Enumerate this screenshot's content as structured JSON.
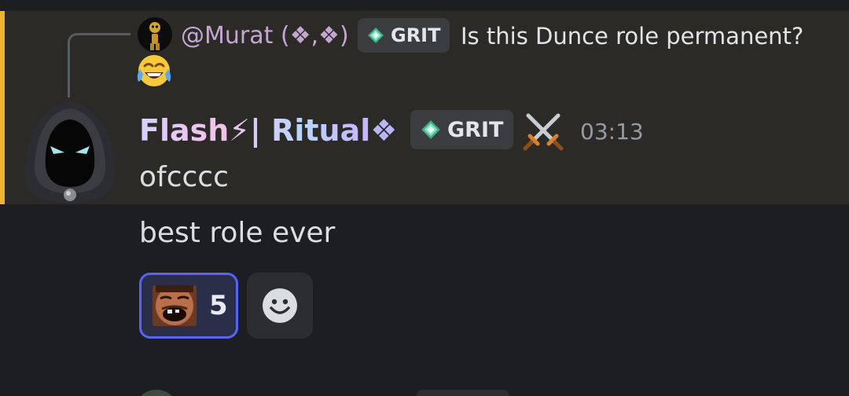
{
  "reply": {
    "author": "@Murat (❖,❖)",
    "tag_label": "GRIT",
    "text": "Is this Dunce role permanent?",
    "emoji_icon": "face-with-tears-of-joy-icon"
  },
  "message": {
    "author_name": "Flash⚡| Ritual",
    "author_suffix": "❖",
    "tag_label": "GRIT",
    "badge_icon": "crossed-swords-icon",
    "timestamp": "03:13",
    "lines": [
      "ofcccc",
      "best role ever"
    ]
  },
  "reactions": [
    {
      "emoji_icon": "laughing-man-emoji-icon",
      "count": "5",
      "active": true
    }
  ],
  "colors": {
    "background": "#1d1e22",
    "highlight_background": "#2b2a27",
    "highlight_accent": "#f0b232",
    "reply_author": "#c4a6d2",
    "timestamp": "#949ba4",
    "reaction_active_border": "#5865f2",
    "reaction_active_bg": "#2b2e48",
    "tag_bg": "#3b3c40",
    "message_text": "#dbdee1"
  }
}
